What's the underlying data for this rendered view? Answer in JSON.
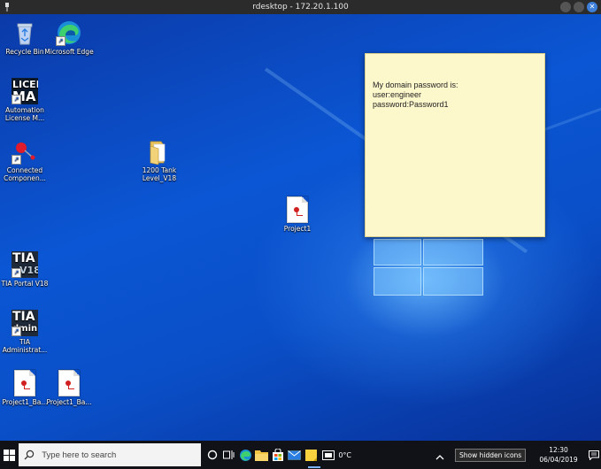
{
  "window": {
    "title": "rdesktop - 172.20.1.100"
  },
  "desktop_icons": [
    {
      "label": "Recycle Bin",
      "icon": "recycle-bin-icon"
    },
    {
      "label": "Microsoft Edge",
      "icon": "edge-icon"
    },
    {
      "label": "Automation License M...",
      "icon": "license-manager-icon",
      "tile_text_1": "LICEN",
      "tile_text_2": "MA"
    },
    {
      "label": "Connected Componen...",
      "icon": "connected-components-icon"
    },
    {
      "label": "1200 Tank Level_V18",
      "icon": "folder-icon"
    },
    {
      "label": "Project1",
      "icon": "document-icon"
    },
    {
      "label": "TIA Portal V18",
      "icon": "tia-portal-icon",
      "tile_text_1": "TIA",
      "tile_text_2": "V18"
    },
    {
      "label": "TIA Administrat...",
      "icon": "tia-admin-icon",
      "tile_text_1": "TIA",
      "tile_text_2": "dmin"
    },
    {
      "label": "Project1_Ba...",
      "icon": "document-icon"
    },
    {
      "label": "Project1_Ba...",
      "icon": "document-icon"
    }
  ],
  "sticky_note": {
    "text": "My domain password is:\nuser:engineer\npassword:Password1"
  },
  "taskbar": {
    "search_placeholder": "Type here to search",
    "weather": "0°C",
    "tooltip": "Show hidden icons",
    "clock_time": "12:30",
    "clock_date": "06/04/2019"
  },
  "colors": {
    "accent": "#0a4fc8",
    "sticky": "#fdf7cc",
    "taskbar": "#101218"
  }
}
